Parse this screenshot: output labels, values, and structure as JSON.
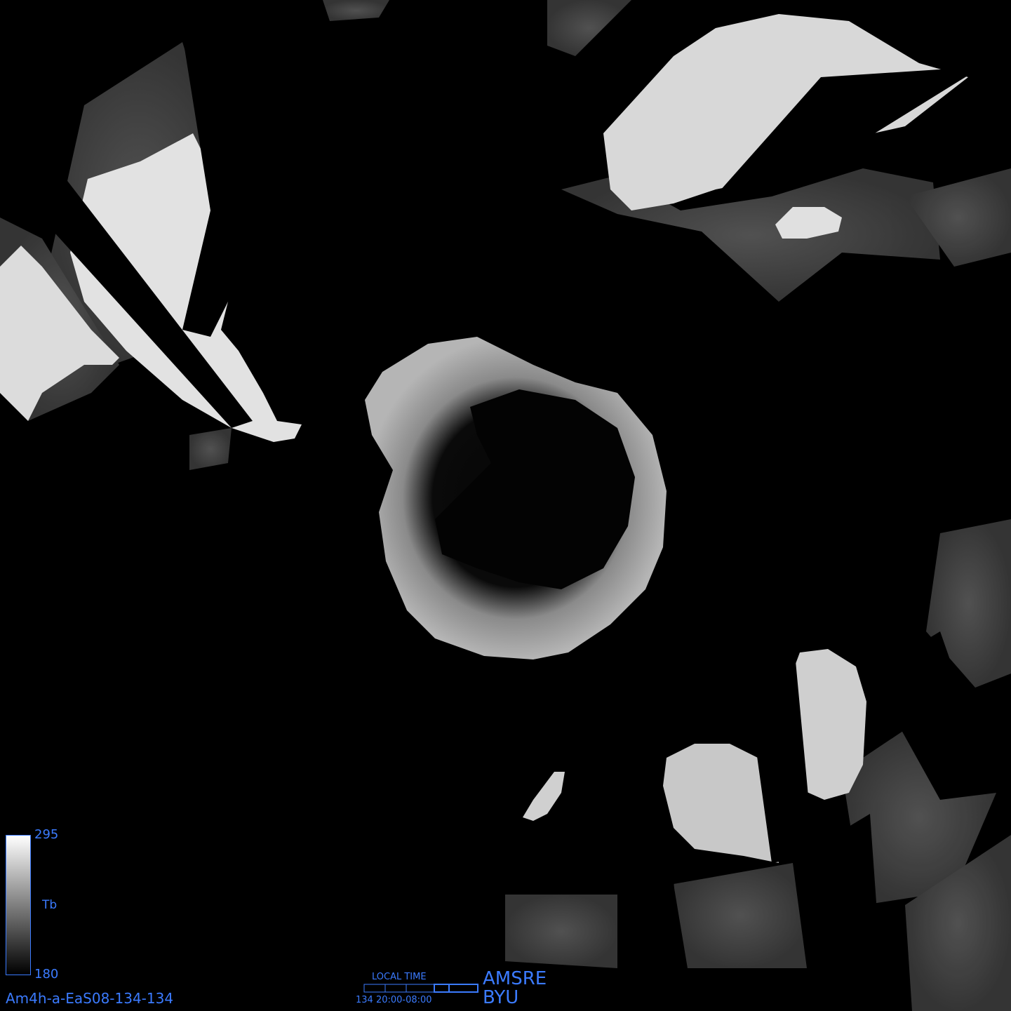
{
  "map": {
    "product_id": "Am4h-a-EaS08-134-134",
    "colorbar": {
      "max_label": "295",
      "min_label": "180",
      "variable_label": "Tb"
    },
    "time_legend": {
      "title": "LOCAL TIME",
      "range": "134  20:00-08:00"
    },
    "sensor": "AMSRE",
    "institution": "BYU",
    "colors": {
      "accent": "#3b7bff",
      "background": "#000000"
    }
  }
}
